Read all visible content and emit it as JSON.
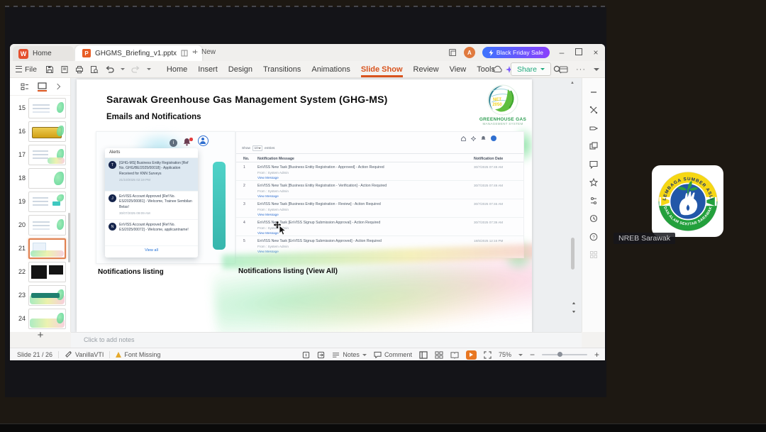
{
  "glyphs": {
    "more": "···",
    "asterisk": "*",
    "minimize": "–",
    "close": "×",
    "plus": "+",
    "up_arrow": "▲",
    "nav_up": "▴▴",
    "nav_down": "▾▾"
  },
  "meeting": {
    "participant_label": "NREB Sarawak",
    "logo_top_text": "LEMBAGA SUMBER ASLI",
    "logo_bottom_text": "DAN ALAM SEKITAR SARAWAK"
  },
  "window": {
    "home_icon": "W",
    "home_tab": "Home",
    "doc_icon": "P",
    "doc_tab": "GHGMS_Briefing_v1.pptx",
    "new_label": "New",
    "promo_label": "Black Friday Sale",
    "avatar_initial": "A"
  },
  "menubar": {
    "file": "File",
    "items": [
      "Home",
      "Insert",
      "Design",
      "Transitions",
      "Animations",
      "Slide Show",
      "Review",
      "View",
      "Tools",
      "WPS AI"
    ],
    "share": "Share"
  },
  "sidebar": {
    "slides": [
      {
        "num": "15"
      },
      {
        "num": "16"
      },
      {
        "num": "17"
      },
      {
        "num": "18"
      },
      {
        "num": "19"
      },
      {
        "num": "20"
      },
      {
        "num": "21"
      },
      {
        "num": "22"
      },
      {
        "num": "23"
      },
      {
        "num": "24"
      }
    ]
  },
  "slide": {
    "title": "Sarawak Greenhouse Gas Management System (GHG-MS)",
    "subtitle": "Emails and Notifications",
    "logo": {
      "badge1": "NET",
      "badge2": "2050",
      "line1": "GREENHOUSE GAS",
      "line2": "MANAGEMENT SYSTEM"
    },
    "caption_left": "Notifications listing",
    "caption_right": "Notifications listing (View All)",
    "alerts": {
      "header": "Alerts",
      "view_all": "View all",
      "items": [
        {
          "initial": "T",
          "text": "[GHG-MS] Business Entity Registration [Ref No. GHG/BE/2025/00018] - Application Received for KNN Surveys",
          "time": "21/10/2025 02:19 PM"
        },
        {
          "initial": "J",
          "text": "EnVISS Account Approved [Ref No. ES/2025/00081] - Welcome, Trainee Sembilan Belas!",
          "time": "30/07/2025 09:09 AM"
        },
        {
          "initial": "N",
          "text": "EnVISS Account Approved [Ref No. ES/2025/00072] - Welcome, applicantname!",
          "time": ""
        }
      ]
    },
    "table": {
      "show_prefix": "Show",
      "show_value": "10",
      "show_suffix": "entries",
      "col_no": "No.",
      "col_msg": "Notification Message",
      "col_date": "Notification Date",
      "from_line": "From : System Admin",
      "link_label": "View Message",
      "rows": [
        {
          "no": "1",
          "msg": "EnVISS New Task [Business Entity Registration - Approved] - Action Required",
          "date": "30/7/2025 07:49 AM"
        },
        {
          "no": "2",
          "msg": "EnVISS New Task [Business Entity Registration - Verification] - Action Required",
          "date": "30/7/2025 07:49 AM"
        },
        {
          "no": "3",
          "msg": "EnVISS New Task [Business Entity Registration - Review] - Action Required",
          "date": "30/7/2025 07:46 AM"
        },
        {
          "no": "4",
          "msg": "EnVISS New Task [EnVISS Signup Submission Approval] - Action Required",
          "date": "30/7/2025 07:39 AM"
        },
        {
          "no": "5",
          "msg": "EnVISS New Task [EnVISS Signup Submission Approved] - Action Required",
          "date": "18/6/2025 12:16 PM"
        }
      ]
    }
  },
  "notes": {
    "placeholder": "Click to add notes"
  },
  "statusbar": {
    "slide_indicator": "Slide 21 / 26",
    "theme_name": "VanillaVTI",
    "font_missing": "Font Missing",
    "notes_label": "Notes",
    "comment_label": "Comment",
    "zoom_level": "75%"
  }
}
